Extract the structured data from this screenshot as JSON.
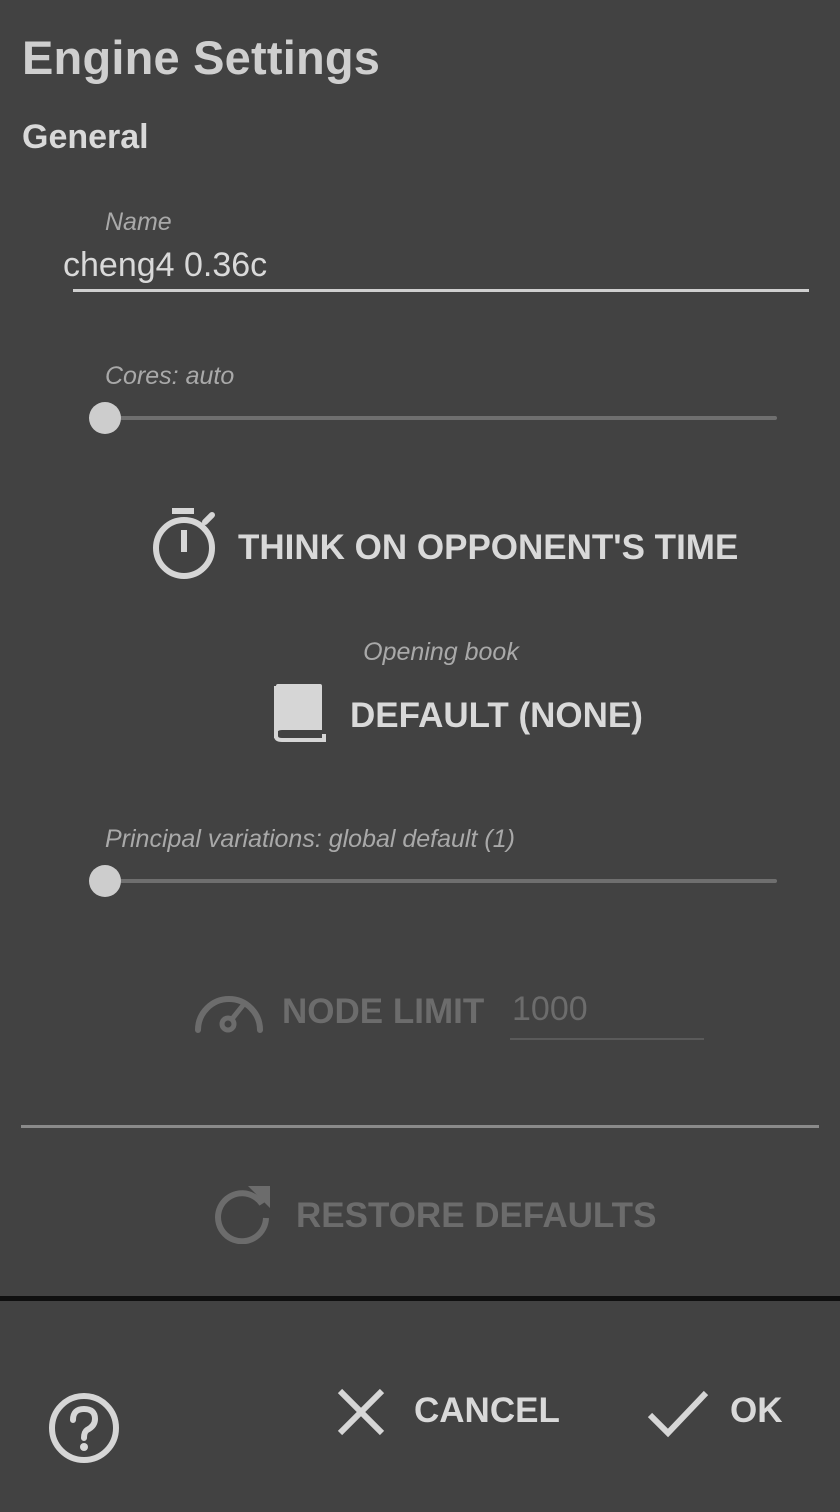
{
  "dialog": {
    "title": "Engine Settings",
    "section_general": "General"
  },
  "name_field": {
    "label": "Name",
    "value": "cheng4 0.36c"
  },
  "cores": {
    "label": "Cores: auto",
    "level": 0
  },
  "ponder": {
    "label": "THINK ON OPPONENT'S TIME",
    "icon": "stopwatch-icon"
  },
  "opening_book": {
    "label": "Opening book",
    "value": "DEFAULT (NONE)",
    "icon": "book-icon"
  },
  "pv": {
    "label": "Principal variations: global default (1)",
    "level": 0
  },
  "node_limit": {
    "label": "NODE LIMIT",
    "placeholder": "1000",
    "icon": "speedometer-icon",
    "enabled": false
  },
  "restore": {
    "label": "RESTORE DEFAULTS",
    "icon": "refresh-icon",
    "enabled": false
  },
  "footer": {
    "help_icon": "help-icon",
    "cancel_label": "CANCEL",
    "ok_label": "OK"
  },
  "colors": {
    "background": "#424242",
    "text": "#d9d9d9",
    "hint": "#a9a9a9",
    "disabled": "#6c6c6c",
    "accent": "#cdcdcd"
  }
}
